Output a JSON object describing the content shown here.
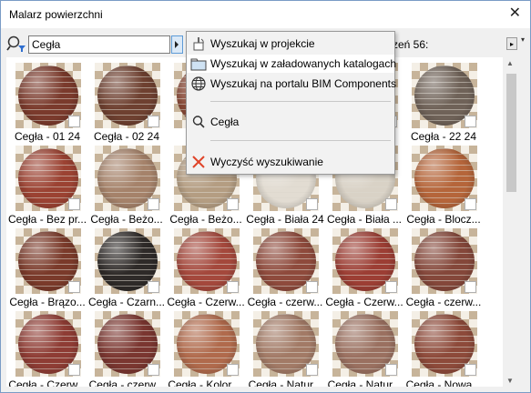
{
  "window": {
    "title": "Malarz powierzchni",
    "close_glyph": "✕"
  },
  "search": {
    "value": "Cegła",
    "placeholder": ""
  },
  "toolbar": {
    "count_label": "czeń 56:",
    "scroll_right_glyph": "▸",
    "menu_caret_glyph": "▾"
  },
  "dropdown_menu": {
    "items": [
      {
        "label": "Wyszukaj w projekcie",
        "icon": "paint-bucket-icon"
      },
      {
        "label": "Wyszukaj w załadowanych katalogach",
        "icon": "folder-icon"
      },
      {
        "label": "Wyszukaj na portalu BIM Components",
        "icon": "globe-icon"
      },
      {
        "label": "Cegła",
        "icon": "search-icon"
      },
      {
        "label": "Wyczyść wyszukiwanie",
        "icon": "clear-x-icon"
      }
    ]
  },
  "materials": [
    {
      "label": "Cegła - 01 24",
      "color": "#7a3a2c"
    },
    {
      "label": "Cegła - 02 24",
      "color": "#6e4030"
    },
    {
      "label": "",
      "color": "#8a4a38"
    },
    {
      "label": "",
      "color": "#7d4a3a"
    },
    {
      "label": "4",
      "color": "#86503e"
    },
    {
      "label": "Cegła - 22 24",
      "color": "#6f6258"
    },
    {
      "label": "Cegła - Bez pr...",
      "color": "#9b4232"
    },
    {
      "label": "Cegła - Beżo...",
      "color": "#a5826a"
    },
    {
      "label": "Cegła - Beżo...",
      "color": "#b49d82"
    },
    {
      "label": "Cegła - Biała 24",
      "color": "#e2dcd2"
    },
    {
      "label": "Cegła - Biała ...",
      "color": "#d9d2c6"
    },
    {
      "label": "Cegła - Blocz...",
      "color": "#b5653a"
    },
    {
      "label": "Cegła - Brązo...",
      "color": "#7a3a2a"
    },
    {
      "label": "Cegła - Czarn...",
      "color": "#2e2a28"
    },
    {
      "label": "Cegła - Czerw...",
      "color": "#a4483c"
    },
    {
      "label": "Cegła - czerw...",
      "color": "#8e4a3c"
    },
    {
      "label": "Cegła - Czerw...",
      "color": "#9c3e34"
    },
    {
      "label": "Cegła - czerw...",
      "color": "#84473a"
    },
    {
      "label": "Cegła - Czerw...",
      "color": "#8e3c34"
    },
    {
      "label": "Cegła - czerw...",
      "color": "#7a3630"
    },
    {
      "label": "Cegła - Kolor ...",
      "color": "#b06a4c"
    },
    {
      "label": "Cegła - Natur...",
      "color": "#a27a66"
    },
    {
      "label": "Cegła - Natur...",
      "color": "#9a7060"
    },
    {
      "label": "Cegła - Nowa...",
      "color": "#8d4a3a"
    }
  ]
}
